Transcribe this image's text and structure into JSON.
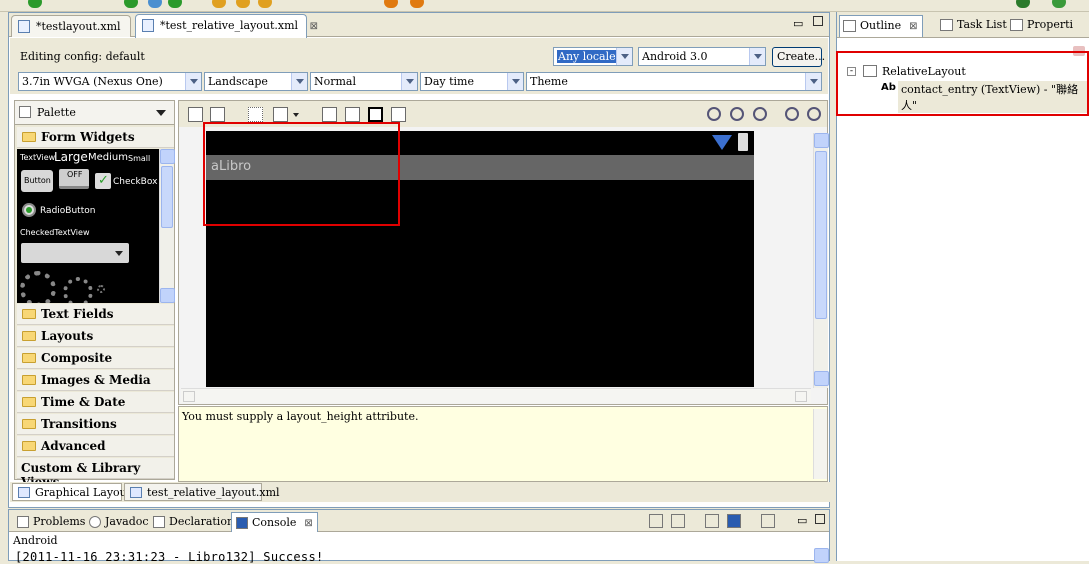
{
  "editor": {
    "tabs": [
      {
        "label": "*testlayout.xml"
      },
      {
        "label": "*test_relative_layout.xml"
      }
    ],
    "close_glyph": "⊠"
  },
  "config": {
    "editing_label": "Editing config:  default",
    "locale": "Any locale",
    "android_version": "Android 3.0",
    "create_button": "Create...",
    "device": "3.7in WVGA (Nexus One)",
    "orientation": "Landscape",
    "mode": "Normal",
    "time": "Day time",
    "theme": "Theme"
  },
  "palette": {
    "title": "Palette",
    "categories": [
      {
        "label": "Form Widgets"
      },
      {
        "label": "Text Fields"
      },
      {
        "label": "Layouts"
      },
      {
        "label": "Composite"
      },
      {
        "label": "Images & Media"
      },
      {
        "label": "Time & Date"
      },
      {
        "label": "Transitions"
      },
      {
        "label": "Advanced"
      },
      {
        "label": "Custom & Library Views"
      }
    ],
    "preview": {
      "textview": "TextView",
      "large": "Large",
      "medium": "Medium",
      "small": "Small",
      "button": "Button",
      "toggle_off": "OFF",
      "checkbox": "CheckBox",
      "radio": "RadioButton",
      "checked_text": "CheckedTextView"
    }
  },
  "canvas": {
    "app_title": "aLibro"
  },
  "error_message": "You must supply a layout_height attribute.",
  "editor_bottom_tabs": [
    {
      "label": "Graphical Layout"
    },
    {
      "label": "test_relative_layout.xml"
    }
  ],
  "bottom_panel": {
    "tabs": [
      {
        "label": "Problems"
      },
      {
        "label": "Javadoc"
      },
      {
        "label": "Declaration"
      },
      {
        "label": "Console"
      }
    ],
    "console_name": "Android",
    "console_line": "[2011-11-16 23:31:23 - Libro132] Success!"
  },
  "outline": {
    "tabs": [
      {
        "label": "Outline"
      },
      {
        "label": "Task List"
      },
      {
        "label": "Properti"
      }
    ],
    "tree": {
      "root": "RelativeLayout",
      "child_prefix": "Ab",
      "child": "contact_entry (TextView) - \"聯絡人\""
    }
  },
  "colors": {
    "highlight_red": "#e00000",
    "selection_blue": "#316ac5",
    "canvas_bg": "#000000",
    "action_bar": "#666666"
  }
}
